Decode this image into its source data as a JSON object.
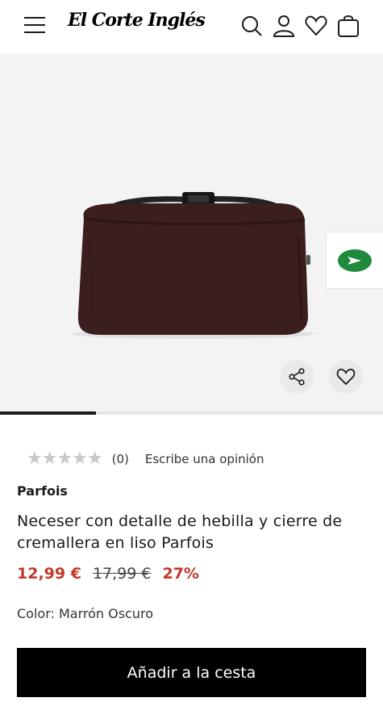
{
  "header": {
    "logo_text": "El Corte Inglés",
    "icons": [
      "menu-icon",
      "search-icon",
      "user-icon",
      "heart-icon",
      "bag-icon"
    ]
  },
  "gallery": {
    "image_subject": "brown toiletry bag",
    "progress_fraction": 0.25
  },
  "rating": {
    "stars_value": 0,
    "stars_max": 5,
    "count": "(0)",
    "review_link": "Escribe una opinión"
  },
  "product": {
    "brand": "Parfois",
    "title": "Neceser con detalle de hebilla y cierre de cremallera en liso Parfois",
    "price_now": "12,99 €",
    "price_old": "17,99 €",
    "discount": "27%",
    "color": "Color: Marrón Oscuro"
  },
  "actions": {
    "add_to_cart": "Añadir a la cesta"
  },
  "colors": {
    "sale_red": "#c0392b",
    "badge_green": "#1f8a3b",
    "button_black": "#000000"
  }
}
